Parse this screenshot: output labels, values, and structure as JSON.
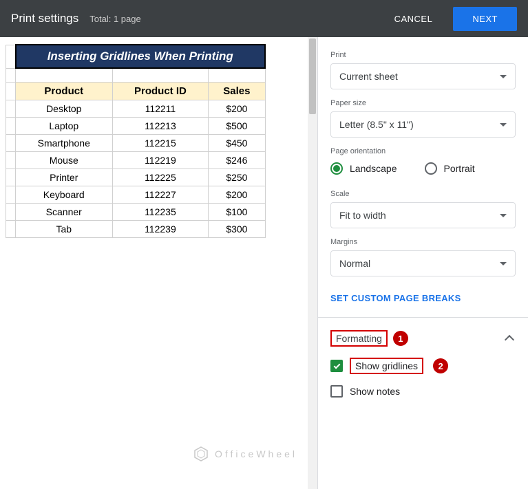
{
  "header": {
    "title": "Print settings",
    "subtitle": "Total: 1 page",
    "cancel": "CANCEL",
    "next": "NEXT"
  },
  "sheet": {
    "title": "Inserting Gridlines When Printing",
    "columns": [
      "Product",
      "Product ID",
      "Sales"
    ],
    "rows": [
      [
        "Desktop",
        "112211",
        "$200"
      ],
      [
        "Laptop",
        "112213",
        "$500"
      ],
      [
        "Smartphone",
        "112215",
        "$450"
      ],
      [
        "Mouse",
        "112219",
        "$246"
      ],
      [
        "Printer",
        "112225",
        "$250"
      ],
      [
        "Keyboard",
        "112227",
        "$200"
      ],
      [
        "Scanner",
        "112235",
        "$100"
      ],
      [
        "Tab",
        "112239",
        "$300"
      ]
    ]
  },
  "settings": {
    "print": {
      "label": "Print",
      "value": "Current sheet"
    },
    "paper": {
      "label": "Paper size",
      "value": "Letter (8.5\" x 11\")"
    },
    "orientation": {
      "label": "Page orientation",
      "landscape": "Landscape",
      "portrait": "Portrait",
      "selected": "landscape"
    },
    "scale": {
      "label": "Scale",
      "value": "Fit to width"
    },
    "margins": {
      "label": "Margins",
      "value": "Normal"
    },
    "custom_breaks": "SET CUSTOM PAGE BREAKS",
    "formatting": {
      "title": "Formatting",
      "badge1": "1",
      "show_gridlines": "Show gridlines",
      "badge2": "2",
      "show_notes": "Show notes"
    }
  },
  "watermark": "OfficeWheel"
}
